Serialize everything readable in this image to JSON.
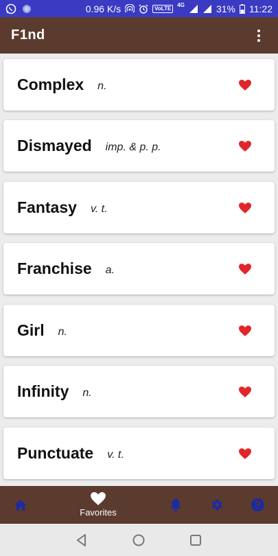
{
  "status_bar": {
    "net_speed": "0.96 K/s",
    "volte": "VoLTE",
    "network": "4G",
    "battery": "31%",
    "time": "11:22"
  },
  "app_bar": {
    "title": "F1nd",
    "menu_icon": "more-vert-icon"
  },
  "words": [
    {
      "word": "Complex",
      "pos": "n."
    },
    {
      "word": "Dismayed",
      "pos": "imp. & p. p."
    },
    {
      "word": "Fantasy",
      "pos": "v. t."
    },
    {
      "word": "Franchise",
      "pos": "a."
    },
    {
      "word": "Girl",
      "pos": "n."
    },
    {
      "word": "Infinity",
      "pos": "n."
    },
    {
      "word": "Punctuate",
      "pos": "v. t."
    }
  ],
  "bottom_nav": {
    "favorites_label": "Favorites",
    "items": [
      "home-icon",
      "favorites-heart-icon",
      "notifications-bell-icon",
      "settings-gear-icon",
      "help-icon"
    ]
  },
  "colors": {
    "status_bar": "#3a3ac2",
    "app_bar": "#5b3b2e",
    "heart": "#e0262b",
    "nav_icon": "#1e2aa0"
  }
}
